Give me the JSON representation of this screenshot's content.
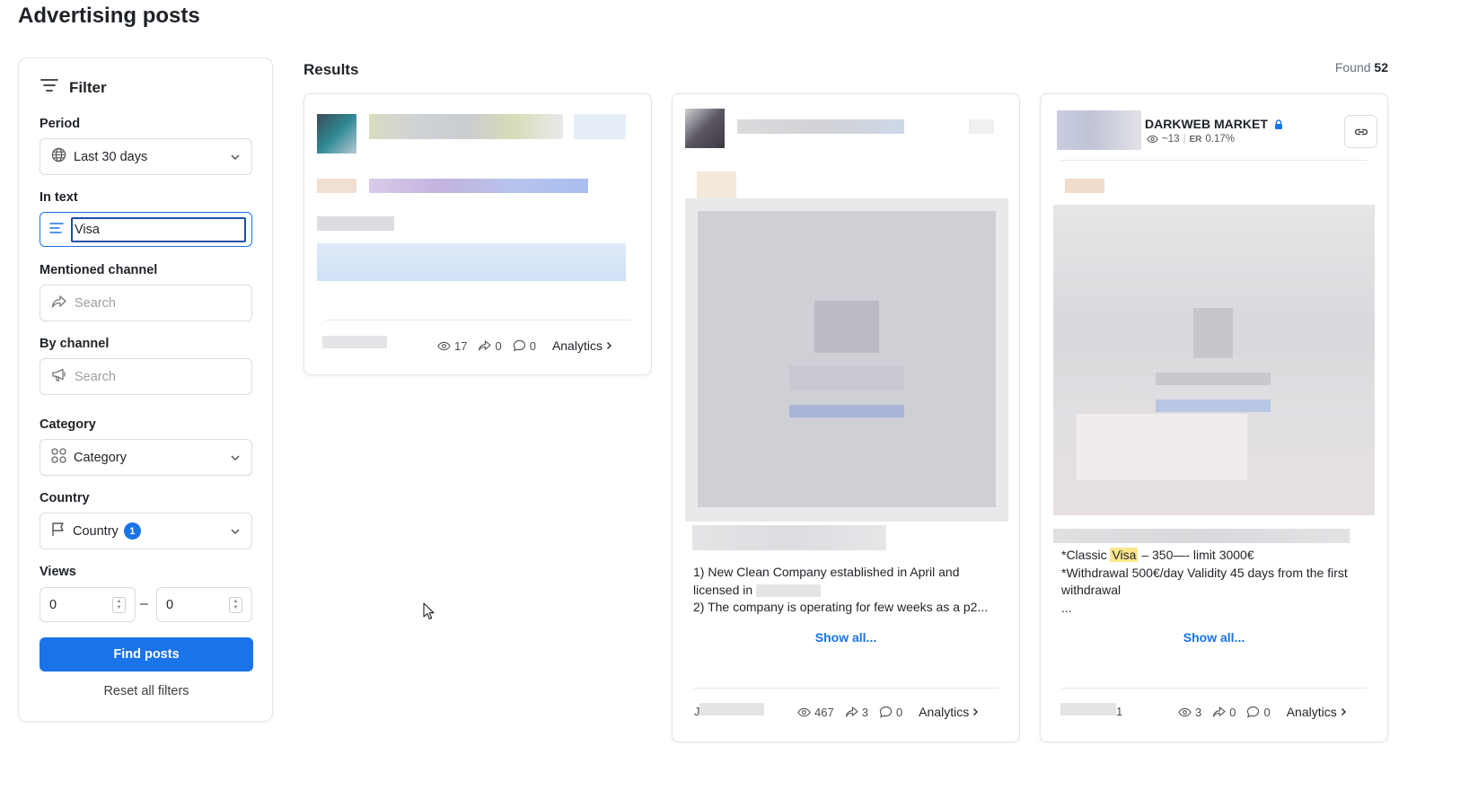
{
  "page": {
    "title": "Advertising posts"
  },
  "filter": {
    "title": "Filter",
    "period": {
      "label": "Period",
      "value": "Last 30 days"
    },
    "in_text": {
      "label": "In text",
      "value": "Visa"
    },
    "mentioned_channel": {
      "label": "Mentioned channel",
      "placeholder": "Search"
    },
    "by_channel": {
      "label": "By channel",
      "placeholder": "Search"
    },
    "category": {
      "label": "Category",
      "value": "Category"
    },
    "country": {
      "label": "Country",
      "value": "Country",
      "badge": "1"
    },
    "views": {
      "label": "Views",
      "min": "0",
      "max": "0",
      "separator": "–"
    },
    "find_button": "Find posts",
    "reset_link": "Reset all filters"
  },
  "results": {
    "title": "Results",
    "found_label": "Found",
    "found_count": "52",
    "cards": [
      {
        "views": "17",
        "shares": "0",
        "comments": "0",
        "analytics": "Analytics"
      },
      {
        "text_line1": "1) New Clean Company established in April and",
        "text_line2": "licensed in",
        "text_line3": "2) The company is operating for few weeks as a p2...",
        "show_all": "Show all...",
        "author_initial": "J",
        "views": "467",
        "shares": "3",
        "comments": "0",
        "analytics": "Analytics"
      },
      {
        "channel_name": "DARKWEB MARKET",
        "subscribers": "~13",
        "er_label": "ER",
        "er_value": "0.17%",
        "text_pre": "*Classic",
        "text_highlight": "Visa",
        "text_post": "– 350—- limit 3000€",
        "text_line2": "*Withdrawal 500€/day Validity 45 days from the first",
        "text_line3": "withdrawal",
        "text_line4": "...",
        "show_all": "Show all...",
        "author_suffix": "1",
        "views": "3",
        "shares": "0",
        "comments": "0",
        "analytics": "Analytics"
      }
    ]
  },
  "colors": {
    "accent": "#1a73e8",
    "highlight": "#fde68a"
  },
  "icons": [
    "filter-icon",
    "globe-icon",
    "text-align-icon",
    "share-arrow-icon",
    "megaphone-icon",
    "category-grid-icon",
    "flag-icon",
    "chevron-down-icon",
    "eye-icon",
    "share-icon",
    "comment-icon",
    "chevron-right-icon",
    "verified-icon",
    "link-icon",
    "cursor-icon"
  ]
}
